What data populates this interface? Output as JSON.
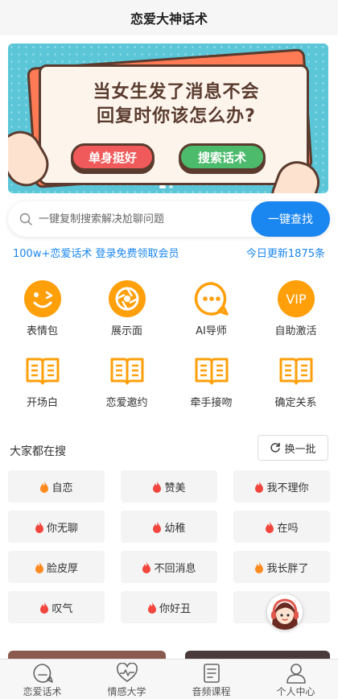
{
  "nav": {
    "title": "恋爱大神话术"
  },
  "banner": {
    "title_line1": "当女生发了消息不会",
    "title_line2": "回复时你该怎么办?",
    "button_left": "单身挺好",
    "button_right": "搜索话术",
    "colors": {
      "background": "#5bc6d8",
      "red": "#f05a5a",
      "green": "#4cbb6c"
    }
  },
  "search": {
    "placeholder": "一键复制搜索解决尬聊问题",
    "button_label": "一键查找",
    "icon": "search-icon"
  },
  "promo": {
    "left_text": "100w+恋爱话术 登录免费领取会员",
    "right_text": "今日更新1875条"
  },
  "features": [
    {
      "label": "表情包",
      "icon": "wink-face-icon"
    },
    {
      "label": "展示面",
      "icon": "camera-aperture-icon"
    },
    {
      "label": "AI导师",
      "icon": "chat-bubble-icon"
    },
    {
      "label": "自助激活",
      "icon": "vip-icon",
      "icon_text": "VIP"
    },
    {
      "label": "开场白",
      "icon": "book-icon"
    },
    {
      "label": "恋爱邀约",
      "icon": "book-icon"
    },
    {
      "label": "牵手接吻",
      "icon": "book-icon"
    },
    {
      "label": "确定关系",
      "icon": "book-icon"
    }
  ],
  "trending": {
    "title": "大家都在搜",
    "refresh_label": "换一批",
    "tags": [
      {
        "label": "自恋",
        "flame": "orange"
      },
      {
        "label": "赞美",
        "flame": "red"
      },
      {
        "label": "我不理你",
        "flame": "red"
      },
      {
        "label": "你无聊",
        "flame": "red"
      },
      {
        "label": "幼稚",
        "flame": "red"
      },
      {
        "label": "在吗",
        "flame": "red"
      },
      {
        "label": "脸皮厚",
        "flame": "orange"
      },
      {
        "label": "不回消息",
        "flame": "red"
      },
      {
        "label": "我长胖了",
        "flame": "orange"
      },
      {
        "label": "叹气",
        "flame": "red"
      },
      {
        "label": "你好丑",
        "flame": "red"
      },
      {
        "label": "",
        "flame": "orange"
      }
    ]
  },
  "tabs": [
    {
      "label": "恋爱话术",
      "icon": "chat-face-icon"
    },
    {
      "label": "情感大学",
      "icon": "heart-pulse-icon"
    },
    {
      "label": "音频课程",
      "icon": "document-icon"
    },
    {
      "label": "个人中心",
      "icon": "user-icon"
    }
  ],
  "colors": {
    "accent": "#1a86f0",
    "feature_orange": "#ff9f0a",
    "flame_red": "#f2453d",
    "flame_orange": "#ff8a1f"
  }
}
